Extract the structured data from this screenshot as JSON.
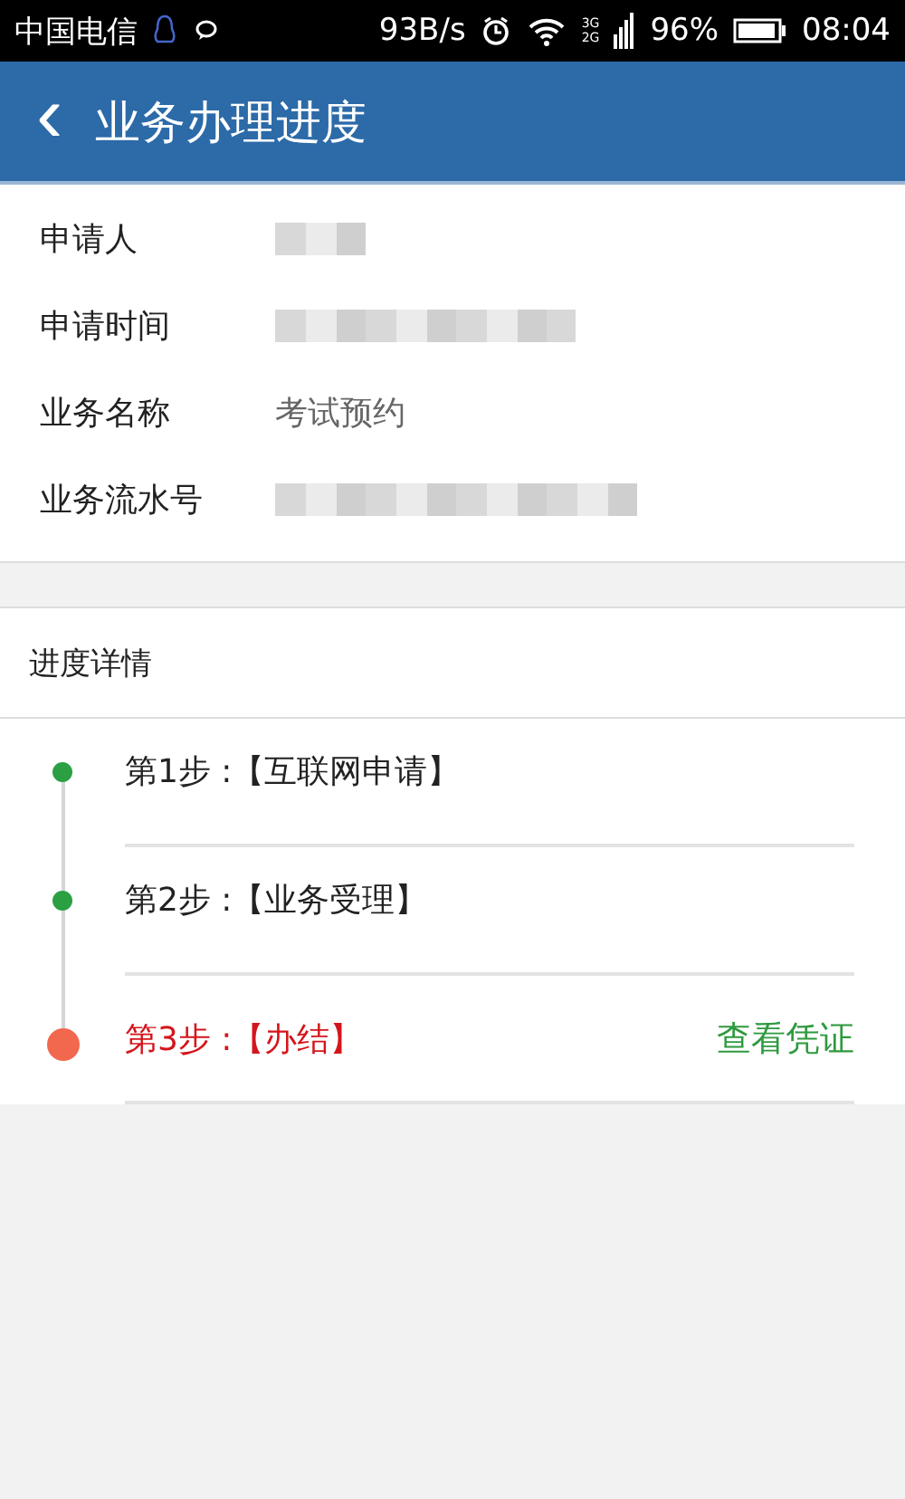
{
  "status_bar": {
    "carrier": "中国电信",
    "speed": "93B/s",
    "network_top": "3G",
    "network_bottom": "2G",
    "battery": "96%",
    "time": "08:04"
  },
  "header": {
    "back": "‹",
    "title": "业务办理进度"
  },
  "fields": [
    {
      "label": "申请人",
      "kind": "redacted"
    },
    {
      "label": "申请时间",
      "kind": "redacted"
    },
    {
      "label": "业务名称",
      "kind": "text",
      "value": "考试预约"
    },
    {
      "label": "业务流水号",
      "kind": "redacted"
    }
  ],
  "progress": {
    "title": "进度详情",
    "steps": [
      {
        "text": "第1步 :【互联网申请】",
        "current": false
      },
      {
        "text": "第2步 :【业务受理】",
        "current": false
      },
      {
        "text": "第3步 :【办结】",
        "current": true,
        "action": "查看凭证"
      }
    ]
  }
}
